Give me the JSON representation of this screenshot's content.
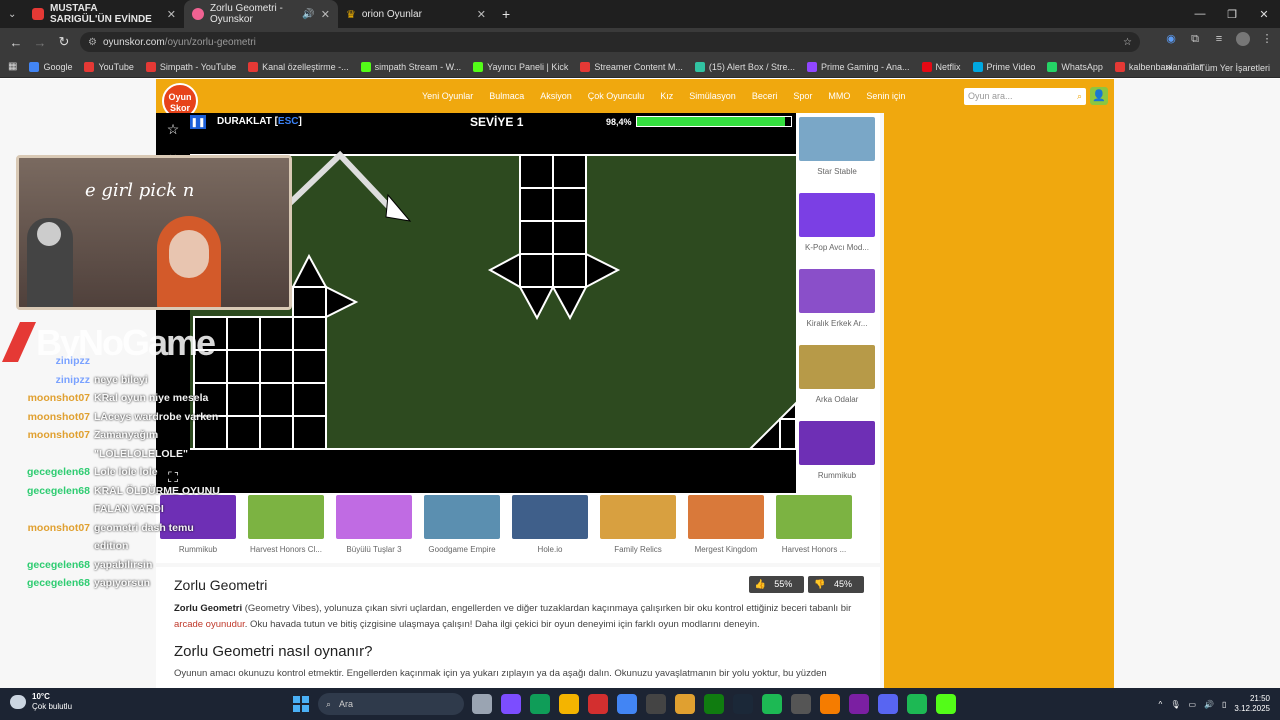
{
  "browser": {
    "tabs": [
      {
        "title": "MUSTAFA SARIGÜL'ÜN EVİNDE",
        "color": "#e53935"
      },
      {
        "title": "Zorlu Geometri - Oyunskor",
        "color": "#f06292"
      },
      {
        "title": "orion Oyunlar",
        "color": "#f4b400"
      }
    ],
    "url_host": "oyunskor.com",
    "url_path": "/oyun/zorlu-geometri",
    "bookmarks": [
      {
        "label": "Google",
        "color": "#4285f4"
      },
      {
        "label": "YouTube",
        "color": "#e53935"
      },
      {
        "label": "Simpath - YouTube",
        "color": "#e53935"
      },
      {
        "label": "Kanal özelleştirme -...",
        "color": "#e53935"
      },
      {
        "label": "simpath Stream - W...",
        "color": "#53fc18"
      },
      {
        "label": "Yayıncı Paneli | Kick",
        "color": "#53fc18"
      },
      {
        "label": "Streamer Content M...",
        "color": "#e53935"
      },
      {
        "label": "(15) Alert Box / Stre...",
        "color": "#31c3a2"
      },
      {
        "label": "Prime Gaming - Ana...",
        "color": "#9146ff"
      },
      {
        "label": "Netflix",
        "color": "#e50914"
      },
      {
        "label": "Prime Video",
        "color": "#00a8e1"
      },
      {
        "label": "WhatsApp",
        "color": "#25d366"
      },
      {
        "label": "kalbenbanlananlar",
        "color": "#e53935"
      }
    ],
    "all_bookmarks": "Tüm Yer İşaretleri"
  },
  "site": {
    "logo": "Oyun Skor",
    "nav": [
      "Yeni Oyunlar",
      "Bulmaca",
      "Aksiyon",
      "Çok Oyunculu",
      "Kız",
      "Simülasyon",
      "Beceri",
      "Spor",
      "MMO",
      "Senin için"
    ],
    "search_placeholder": "Oyun ara..."
  },
  "game": {
    "pause_label": "DURAKLAT [",
    "pause_key": "ESC",
    "pause_close": "]",
    "level": "SEVİYE 1",
    "progress_text": "98,4%",
    "progress": 0.96
  },
  "rail": [
    {
      "label": "Star Stable",
      "color": "#7aa7c7"
    },
    {
      "label": "K-Pop Avcı Mod...",
      "color": "#7b3fe4"
    },
    {
      "label": "Kiralık Erkek Ar...",
      "color": "#8a4fc9"
    },
    {
      "label": "Arka Odalar",
      "color": "#b79a48"
    },
    {
      "label": "Rummikub",
      "color": "#6e2fb5"
    }
  ],
  "bottom_games": [
    {
      "label": "Rummikub",
      "color": "#6e2fb5"
    },
    {
      "label": "Harvest Honors Cl...",
      "color": "#7cb342"
    },
    {
      "label": "Büyülü Tuşlar 3",
      "color": "#c06be3"
    },
    {
      "label": "Goodgame Empire",
      "color": "#5b8fb0"
    },
    {
      "label": "Hole.io",
      "color": "#3f5f8a"
    },
    {
      "label": "Family Relics",
      "color": "#d8a040"
    },
    {
      "label": "Mergest Kingdom",
      "color": "#d9793a"
    },
    {
      "label": "Harvest Honors ...",
      "color": "#7cb342"
    }
  ],
  "description": {
    "title": "Zorlu Geometri",
    "likes": "55%",
    "dislikes": "45%",
    "p1_bold": "Zorlu Geometri",
    "p1_a": " (Geometry Vibes), yolunuza çıkan sivri uçlardan, engellerden ve diğer tuzaklardan kaçınmaya çalışırken bir oku kontrol ettiğiniz beceri tabanlı bir ",
    "p1_link": "arcade oyunudur",
    "p1_b": ". Oku havada tutun ve bitiş çizgisine ulaşmaya çalışın! Daha ilgi çekici bir oyun deneyimi için farklı oyun modlarını deneyin.",
    "h2": "Zorlu Geometri nasıl oynanır?",
    "p2": "Oyunun amacı okunuzu kontrol etmektir. Engellerden kaçınmak için ya yukarı zıplayın ya da aşağı dalın. Okunuzu yavaşlatmanın bir yolu yoktur, bu yüzden"
  },
  "stream": {
    "cam_text": "e girl pick n",
    "brand": "ByNoGame",
    "chat": [
      {
        "user": "zinipzz",
        "msg": "",
        "color": "#7aa2ff"
      },
      {
        "user": "zinipzz",
        "msg": "neye bileyi",
        "color": "#7aa2ff"
      },
      {
        "user": "moonshot07",
        "msg": "KRal oyun niye mesela",
        "color": "#e0a030"
      },
      {
        "user": "moonshot07",
        "msg": "LAceys wardrobe varken",
        "color": "#e0a030"
      },
      {
        "user": "moonshot07",
        "msg": "Zamanyağım",
        "color": "#e0a030"
      },
      {
        "user": "",
        "msg": "\"LOLELOLELOLE\"",
        "color": "#e0a030"
      },
      {
        "user": "gecegelen68",
        "msg": "Lole lole lole",
        "color": "#2ecc71"
      },
      {
        "user": "gecegelen68",
        "msg": "KRAL ÖLDÜRME OYUNU",
        "color": "#2ecc71"
      },
      {
        "user": "",
        "msg": "FALAN VARDI",
        "color": "#2ecc71"
      },
      {
        "user": "moonshot07",
        "msg": "geometri dash temu",
        "color": "#e0a030"
      },
      {
        "user": "",
        "msg": "edition",
        "color": "#e0a030"
      },
      {
        "user": "gecegelen68",
        "msg": "yapabilirsin",
        "color": "#2ecc71"
      },
      {
        "user": "gecegelen68",
        "msg": "yapıyorsun",
        "color": "#2ecc71"
      }
    ]
  },
  "taskbar": {
    "temp": "10°C",
    "weather": "Çok bulutlu",
    "search": "Ara",
    "time": "21:50",
    "date": "3.12.2025",
    "apps": [
      "#9aa4b2",
      "#7c4dff",
      "#0f9d58",
      "#f4b400",
      "#d32f2f",
      "#4285f4",
      "#444",
      "#e0a030",
      "#107c10",
      "#1b2838",
      "#1db954",
      "#555",
      "#f57c00",
      "#7b1fa2",
      "#5865f2",
      "#1db954",
      "#53fc18"
    ]
  }
}
